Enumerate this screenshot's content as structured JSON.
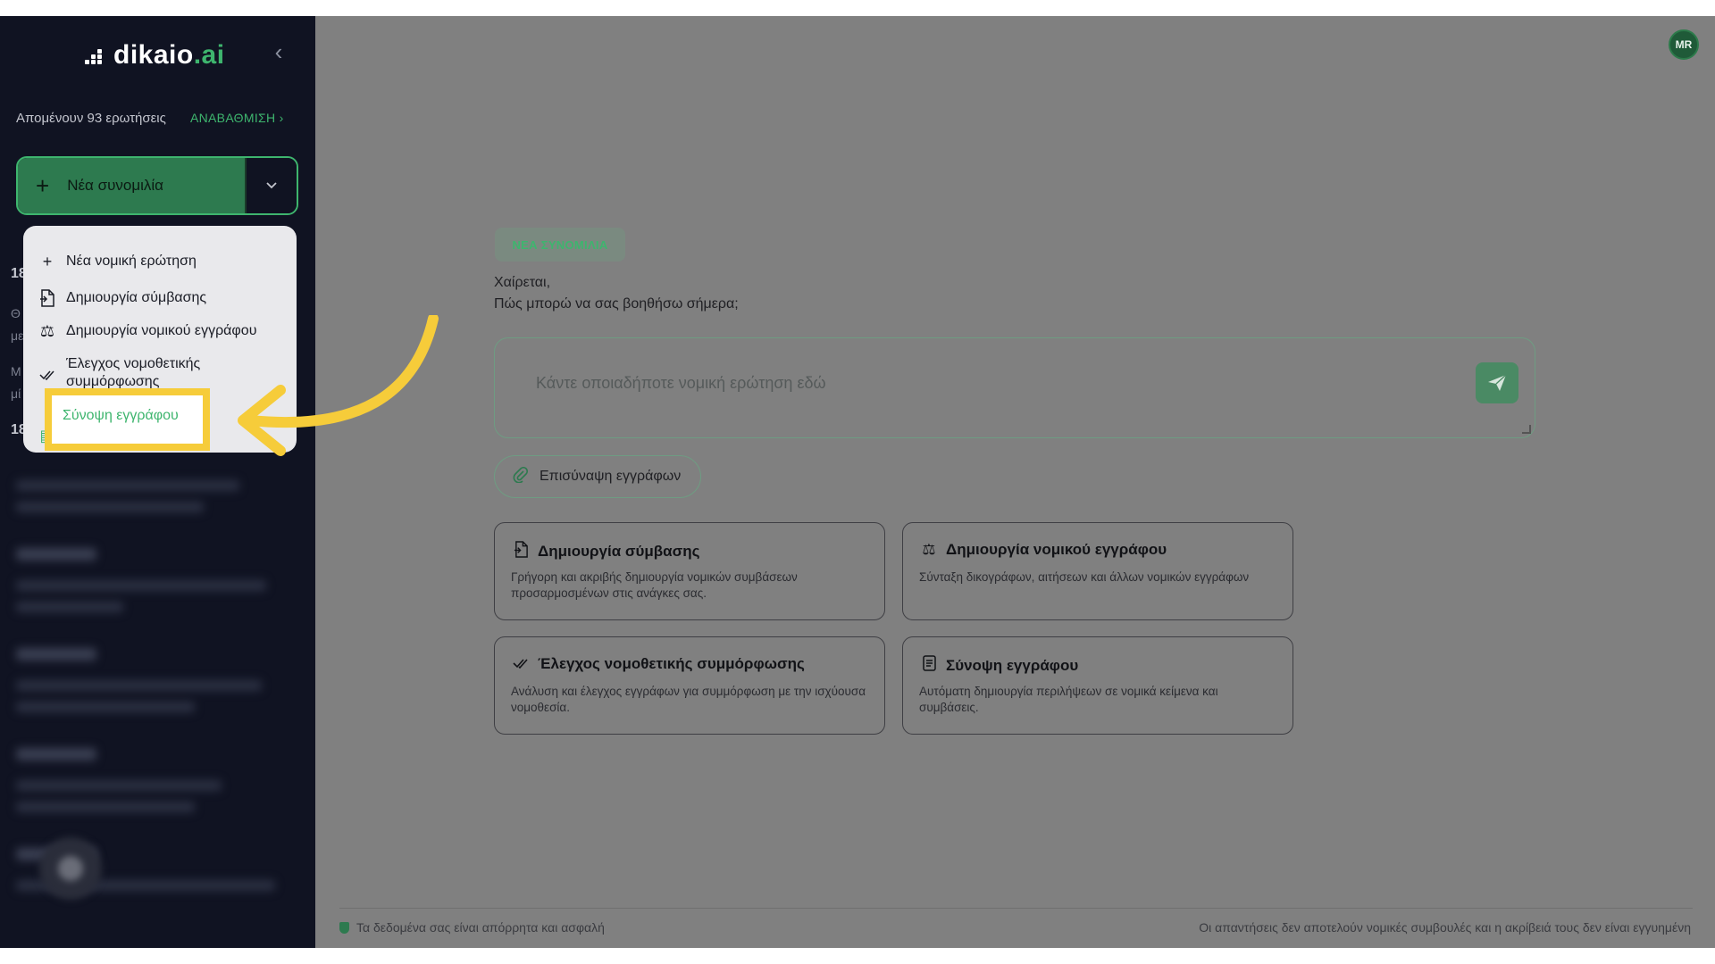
{
  "app": {
    "logo_text": "dikaio",
    "logo_suffix": ".ai",
    "user_initials": "MR"
  },
  "sidebar": {
    "quota_text": "Απομένουν 93 ερωτήσεις",
    "upgrade_label": "ΑΝΑΒΑΘΜΙΣΗ ›",
    "new_chat_label": "Νέα συνομιλία",
    "peek_texts": [
      "18",
      "Θ",
      "με",
      "Μ",
      "μί",
      "18"
    ]
  },
  "menu": {
    "items": [
      {
        "icon": "plus-icon",
        "label": "Νέα νομική ερώτηση"
      },
      {
        "icon": "contract-doc-icon",
        "label": "Δημιουργία σύμβασης"
      },
      {
        "icon": "scales-icon",
        "label": "Δημιουργία νομικού εγγράφου"
      },
      {
        "icon": "double-check-icon",
        "label": "Έλεγχος νομοθετικής συμμόρφωσης"
      },
      {
        "icon": "doc-summary-icon",
        "label": "Σύνοψη εγγράφου"
      }
    ],
    "highlighted_label": "Σύνοψη εγγράφου"
  },
  "main": {
    "badge": "ΝΕΑ ΣΥΝΟΜΙΛΙΑ",
    "greeting_line1": "Χαίρεται,",
    "greeting_line2": "Πώς μπορώ να σας βοηθήσω σήμερα;",
    "question_placeholder": "Κάντε οποιαδήποτε νομική ερώτηση εδώ",
    "attach_label": "Επισύναψη εγγράφων",
    "cards": [
      {
        "icon": "contract-doc-icon",
        "title": "Δημιουργία σύμβασης",
        "desc": "Γρήγορη και ακριβής δημιουργία νομικών συμβάσεων προσαρμοσμένων στις ανάγκες σας."
      },
      {
        "icon": "scales-icon",
        "title": "Δημιουργία νομικού εγγράφου",
        "desc": "Σύνταξη δικογράφων, αιτήσεων και άλλων νομικών εγγράφων"
      },
      {
        "icon": "double-check-icon",
        "title": "Έλεγχος νομοθετικής συμμόρφωσης",
        "desc": "Ανάλυση και έλεγχος εγγράφων για συμμόρφωση με την ισχύουσα νομοθεσία."
      },
      {
        "icon": "doc-summary-icon",
        "title": "Σύνοψη εγγράφου",
        "desc": "Αυτόματη δημιουργία περιλήψεων σε νομικά κείμενα και συμβάσεις."
      }
    ]
  },
  "footer": {
    "privacy_text": "Τα δεδομένα σας είναι απόρρητα και ασφαλή",
    "disclaimer_text": "Οι απαντήσεις δεν αποτελούν νομικές συμβουλές και η ακρίβειά τους δεν είναι εγγυημένη"
  },
  "colors": {
    "accent": "#3eb56e",
    "sidebar_bg": "#101322",
    "overlay_bg": "#808080",
    "annotation_yellow": "#f6cc3a"
  }
}
